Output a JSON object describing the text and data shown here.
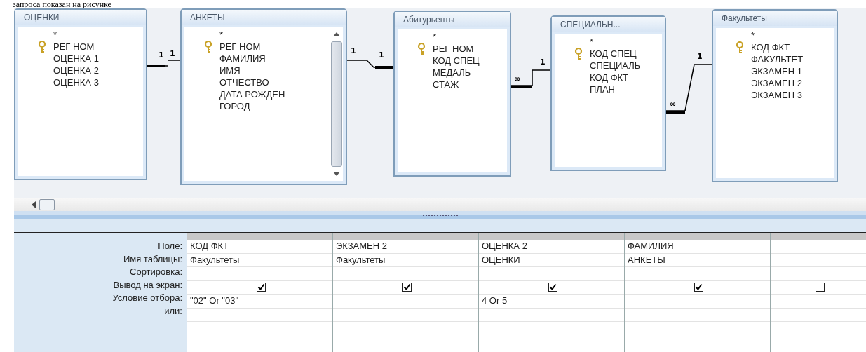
{
  "caption": "запроса показан на рисунке",
  "tables": [
    {
      "title": "ОЦЕНКИ",
      "scrollbar": false,
      "fields": [
        {
          "name": "*",
          "key": false
        },
        {
          "name": "РЕГ НОМ",
          "key": true
        },
        {
          "name": "ОЦЕНКА 1",
          "key": false
        },
        {
          "name": "ОЦЕНКА 2",
          "key": false
        },
        {
          "name": "ОЦЕНКА 3",
          "key": false
        }
      ]
    },
    {
      "title": "АНКЕТЫ",
      "scrollbar": true,
      "fields": [
        {
          "name": "*",
          "key": false
        },
        {
          "name": "РЕГ НОМ",
          "key": true
        },
        {
          "name": "ФАМИЛИЯ",
          "key": false
        },
        {
          "name": "ИМЯ",
          "key": false
        },
        {
          "name": "ОТЧЕСТВО",
          "key": false
        },
        {
          "name": "ДАТА РОЖДЕН",
          "key": false
        },
        {
          "name": "ГОРОД",
          "key": false
        }
      ]
    },
    {
      "title": "Абитурьенты",
      "scrollbar": false,
      "fields": [
        {
          "name": "*",
          "key": false
        },
        {
          "name": "РЕГ НОМ",
          "key": true
        },
        {
          "name": "КОД СПЕЦ",
          "key": false
        },
        {
          "name": "МЕДАЛЬ",
          "key": false
        },
        {
          "name": "СТАЖ",
          "key": false
        }
      ]
    },
    {
      "title": "СПЕЦИАЛЬН...",
      "scrollbar": false,
      "fields": [
        {
          "name": "*",
          "key": false
        },
        {
          "name": "КОД СПЕЦ",
          "key": true
        },
        {
          "name": "СПЕЦИАЛЬ",
          "key": false
        },
        {
          "name": "КОД ФКТ",
          "key": false
        },
        {
          "name": "ПЛАН",
          "key": false
        }
      ]
    },
    {
      "title": "Факультеты",
      "scrollbar": false,
      "fields": [
        {
          "name": "*",
          "key": false
        },
        {
          "name": "КОД ФКТ",
          "key": true
        },
        {
          "name": "ФАКУЛЬТЕТ",
          "key": false
        },
        {
          "name": "ЭКЗАМЕН 1",
          "key": false
        },
        {
          "name": "ЭКЗАМЕН 2",
          "key": false
        },
        {
          "name": "ЭКЗАМЕН 3",
          "key": false
        }
      ]
    }
  ],
  "relations": [
    {
      "from_label": "1",
      "to_label": "1"
    },
    {
      "from_label": "1",
      "to_label": "1"
    },
    {
      "from_label": "∞",
      "to_label": "1"
    },
    {
      "from_label": "∞",
      "to_label": "1"
    }
  ],
  "grid": {
    "row_labels": [
      "Поле:",
      "Имя таблицы:",
      "Сортировка:",
      "Вывод на экран:",
      "Условие отбора:",
      "или:"
    ],
    "columns": [
      {
        "field": "КОД ФКТ",
        "table": "Факультеты",
        "show": true,
        "criteria": "\"02\" Or \"03\""
      },
      {
        "field": "ЭКЗАМЕН 2",
        "table": "Факультеты",
        "show": true
      },
      {
        "field": "ОЦЕНКА 2",
        "table": "ОЦЕНКИ",
        "show": true,
        "criteria": "4 Or 5"
      },
      {
        "field": "ФАМИЛИЯ",
        "table": "АНКЕТЫ",
        "show": true
      },
      {
        "show": false
      }
    ]
  }
}
